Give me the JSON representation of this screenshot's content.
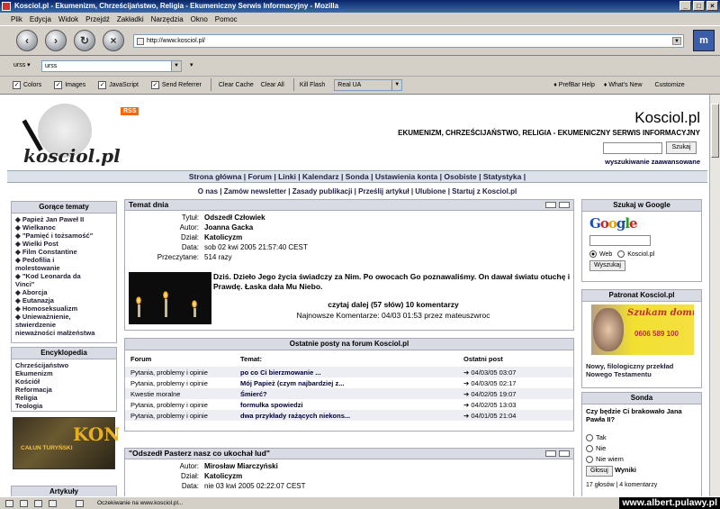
{
  "window": {
    "title": "Kosciol.pl - Ekumenizm, Chrześcijaństwo, Religia - Ekumeniczny Serwis Informacyjny - Mozilla"
  },
  "menu": [
    "Plik",
    "Edycja",
    "Widok",
    "Przejdź",
    "Zakładki",
    "Narzędzia",
    "Okno",
    "Pomoc"
  ],
  "nav": {
    "url": "http://www.kosciol.pl/"
  },
  "toolbar": {
    "profile_select": "urss",
    "profile_field": "urss",
    "checks": [
      {
        "label": "Colors",
        "checked": true
      },
      {
        "label": "Images",
        "checked": true
      },
      {
        "label": "JavaScript",
        "checked": true
      },
      {
        "label": "Send Referrer",
        "checked": true
      }
    ],
    "clear_cache": "Clear Cache",
    "clear_all": "Clear All",
    "kill_flash": "Kill Flash",
    "ua_select": "Real UA",
    "prefbar_help": "PrefBar Help",
    "whats_new": "What's New",
    "customize": "Customize"
  },
  "site": {
    "logo_text": "kosciol.pl",
    "rss": "RSS",
    "title": "Kosciol.pl",
    "subtitle": "EKUMENIZM, CHRZEŚCIJAŃSTWO, RELIGIA - EKUMENICZNY SERWIS INFORMACYJNY",
    "search_button": "Szukaj",
    "advanced_search": "wyszukiwanie zaawansowane",
    "nav_primary": "Strona główna | Forum | Linki | Kalendarz | Sonda | Ustawienia konta | Osobiste | Statystyka |",
    "nav_secondary": "O nas | Zamów newsletter | Zasady publikacji | Prześlij artykuł | Ulubione | Startuj z Kosciol.pl"
  },
  "left": {
    "hot_title": "Gorące tematy",
    "hot_items": [
      "◆ Papież Jan Paweł II",
      "◆ Wielkanoc",
      "◆ \"Pamięć i tożsamość\"",
      "◆ Wielki Post",
      "◆ Film Constantine",
      "◆ Pedofilia i",
      "molestowanie",
      "◆ \"Kod Leonarda da",
      "Vinci\"",
      "◆ Aborcja",
      "◆ Eutanazja",
      "◆ Homoseksualizm",
      "◆ Unieważnienie,",
      "stwierdzenie",
      "nieważności małżeństwa"
    ],
    "ency_title": "Encyklopedia",
    "ency_items": [
      "Chrześcijaństwo",
      "Ekumenizm",
      "Kościół",
      "Reformacja",
      "Religia",
      "Teologia"
    ],
    "banner_big": "KON",
    "banner_small": "CAŁUN TURYŃSKI",
    "articles_title": "Artykuły"
  },
  "article1": {
    "section": "Temat dnia",
    "meta": [
      {
        "k": "Tytuł:",
        "v": "Odszedł Człowiek"
      },
      {
        "k": "Autor:",
        "v": "Joanna Gacka"
      },
      {
        "k": "Dział:",
        "v": "Katolicyzm"
      },
      {
        "k": "Data:",
        "v": "sob 02 kwi 2005 21:57:40 CEST"
      },
      {
        "k": "Przeczytane:",
        "v": "514 razy"
      }
    ],
    "lead": "Dziś. Dzieło Jego życia świadczy za Nim. Po owocach Go poznawaliśmy. On dawał światu otuchę i Prawdę. Łaska dała Mu Niebo.",
    "read_more": "czytaj dalej (57 słów) 10 komentarzy",
    "latest_comment": "Najnowsze Komentarze: 04/03 01:53 przez mateuszwroc"
  },
  "forum": {
    "title": "Ostatnie posty na forum Kosciol.pl",
    "headers": [
      "Forum",
      "Temat:",
      "Ostatni post"
    ],
    "rows": [
      [
        "Pytania, problemy i opinie",
        "po co Ci bierzmowanie ...",
        "➔ 04/03/05 03:07"
      ],
      [
        "Pytania, problemy i opinie",
        "Mój Papież (czym najbardziej z...",
        "➔ 04/03/05 02:17"
      ],
      [
        "Kwestie moralne",
        "Śmierć?",
        "➔ 04/02/05 19:07"
      ],
      [
        "Pytania, problemy i opinie",
        "formułka spowiedzi",
        "➔ 04/02/05 13:03"
      ],
      [
        "Pytania, problemy i opinie",
        "dwa przykłady rażących niekons...",
        "➔ 04/01/05 21:04"
      ]
    ]
  },
  "article2": {
    "title": "\"Odszedł Pasterz nasz co ukochał lud\"",
    "meta": [
      {
        "k": "Autor:",
        "v": "Mirosław Miarczyński"
      },
      {
        "k": "Dział:",
        "v": "Katolicyzm"
      },
      {
        "k": "Data:",
        "v": "nie 03 kwi 2005 02:22:07 CEST"
      }
    ]
  },
  "right": {
    "google_title": "Szukaj w Google",
    "google_logo": "Google",
    "radio_web": "Web",
    "radio_site": "Kosciol.pl",
    "google_button": "Wyszukaj",
    "patron_title": "Patronat Kosciol.pl",
    "patron_banner": "Szukam domu",
    "patron_phone": "0606 589 100",
    "patron_link": "Nowy, filologiczny przekład Nowego Testamentu",
    "poll_title": "Sonda",
    "poll_question": "Czy będzie Ci brakowało Jana Pawła II?",
    "poll_options": [
      "Tak",
      "Nie",
      "Nie wiem"
    ],
    "poll_vote": "Głosuj",
    "poll_results": "Wyniki",
    "poll_stats": "17 głosów | 4 komentarzy"
  },
  "status": {
    "message": "Oczekiwanie na www.kosciol.pl...",
    "watermark": "www.albert.pulawy.pl"
  }
}
